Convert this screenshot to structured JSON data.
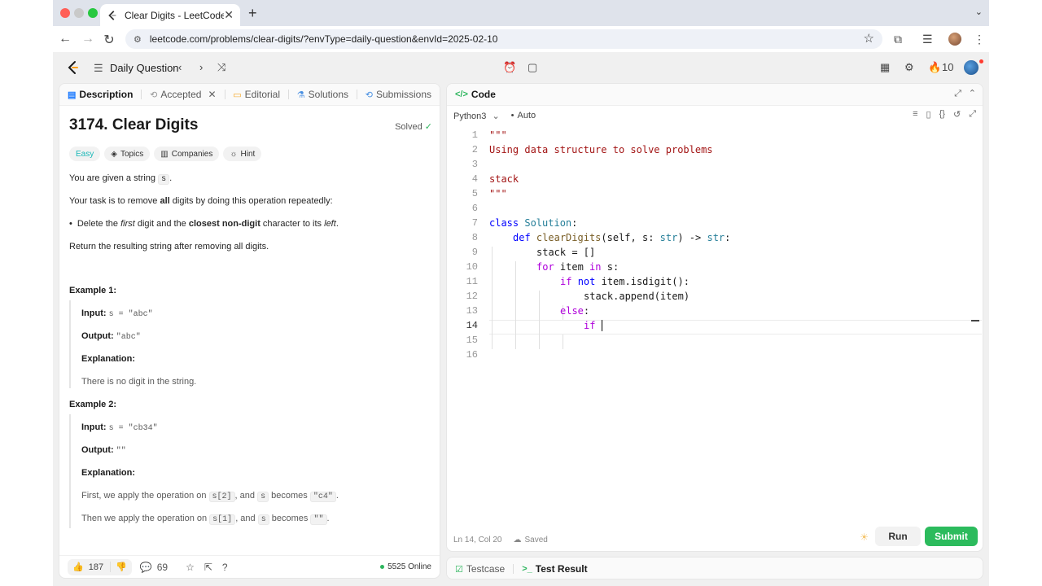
{
  "browser": {
    "tab_title": "Clear Digits - LeetCode",
    "new_tab": "+",
    "url": "leetcode.com/problems/clear-digits/?envType=daily-question&envId=2025-02-10"
  },
  "header": {
    "daily_question": "Daily Question",
    "streak_count": "10"
  },
  "left_tabs": {
    "description": "Description",
    "accepted": "Accepted",
    "editorial": "Editorial",
    "solutions": "Solutions",
    "submissions": "Submissions"
  },
  "problem": {
    "title": "3174. Clear Digits",
    "solved": "Solved",
    "tags": {
      "difficulty": "Easy",
      "topics": "Topics",
      "companies": "Companies",
      "hint": "Hint"
    },
    "p1_a": "You are given a string ",
    "p1_var": "s",
    "p1_b": ".",
    "p2_a": "Your task is to remove ",
    "p2_bold": "all",
    "p2_b": " digits by doing this operation repeatedly:",
    "bullet_a": "Delete the ",
    "bullet_i1": "first",
    "bullet_b": " digit and the ",
    "bullet_bold": "closest non-digit",
    "bullet_c": " character to its ",
    "bullet_i2": "left",
    "bullet_d": ".",
    "p3": "Return the resulting string after removing all digits.",
    "example1": {
      "heading": "Example 1:",
      "input_label": "Input:",
      "input": "s = \"abc\"",
      "output_label": "Output:",
      "output": "\"abc\"",
      "explanation_label": "Explanation:",
      "explanation": "There is no digit in the string."
    },
    "example2": {
      "heading": "Example 2:",
      "input_label": "Input:",
      "input": "s = \"cb34\"",
      "output_label": "Output:",
      "output": "\"\"",
      "explanation_label": "Explanation:",
      "line1_a": "First, we apply the operation on ",
      "line1_code1": "s[2]",
      "line1_b": ", and ",
      "line1_code2": "s",
      "line1_c": " becomes ",
      "line1_code3": "\"c4\"",
      "line1_d": ".",
      "line2_a": "Then we apply the operation on ",
      "line2_code1": "s[1]",
      "line2_b": ", and ",
      "line2_code2": "s",
      "line2_c": " becomes ",
      "line2_code3": "\"\"",
      "line2_d": "."
    }
  },
  "footer": {
    "likes": "187",
    "comments": "69",
    "online": "5525 Online"
  },
  "editor": {
    "header_label": "Code",
    "language": "Python3",
    "auto": "Auto",
    "status_position": "Ln 14, Col 20",
    "status_saved": "Saved",
    "run": "Run",
    "submit": "Submit",
    "line_numbers": [
      "1",
      "2",
      "3",
      "4",
      "5",
      "6",
      "7",
      "8",
      "9",
      "10",
      "11",
      "12",
      "13",
      "14",
      "15",
      "16"
    ],
    "code": {
      "l1": "\"\"\"",
      "l2": "Using data structure to solve problems",
      "l4": "stack",
      "l5": "\"\"\"",
      "l7_kw": "class",
      "l7_name": "Solution",
      "l7_colon": ":",
      "l8_kw": "def",
      "l8_fn": "clearDigits",
      "l8_a": "(self, s: ",
      "l8_t1": "str",
      "l8_b": ") -> ",
      "l8_t2": "str",
      "l8_c": ":",
      "l9": "stack = []",
      "l10_kw": "for",
      "l10_a": " item ",
      "l10_kw2": "in",
      "l10_b": " s:",
      "l11_kw": "if",
      "l11_kw2": "not",
      "l11_a": " item.isdigit():",
      "l12": "stack.append(item)",
      "l13_kw": "else",
      "l13_a": ":",
      "l14_kw": "if"
    }
  },
  "bottom_tabs": {
    "testcase": "Testcase",
    "test_result": "Test Result"
  }
}
